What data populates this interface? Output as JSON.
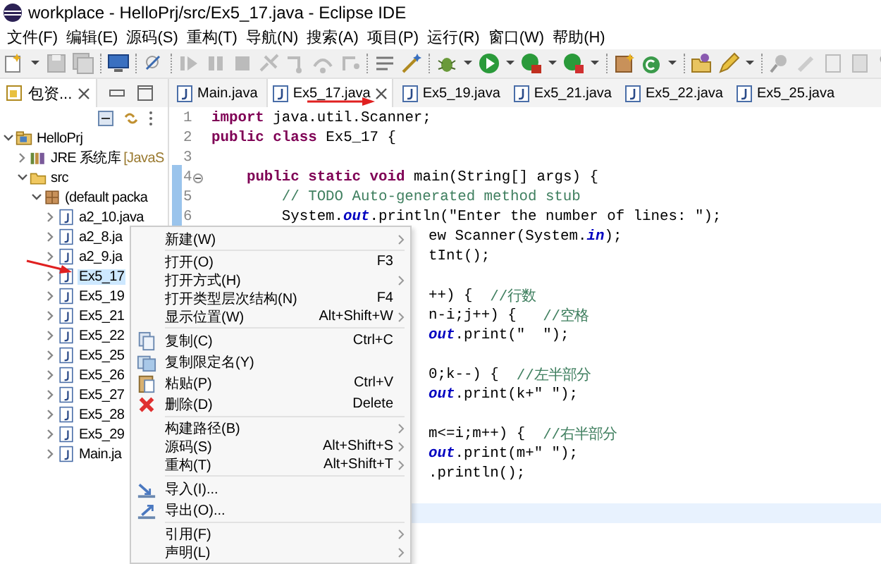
{
  "window": {
    "title": "workplace - HelloPrj/src/Ex5_17.java - Eclipse IDE"
  },
  "menu_bar": [
    "文件(F)",
    "编辑(E)",
    "源码(S)",
    "重构(T)",
    "导航(N)",
    "搜索(A)",
    "项目(P)",
    "运行(R)",
    "窗口(W)",
    "帮助(H)"
  ],
  "explorer": {
    "tab": "包资...",
    "tree": [
      {
        "label": "HelloPrj",
        "kind": "project",
        "expanded": true,
        "selected": false,
        "children": [
          {
            "label": "JRE 系统库",
            "suffix": "[JavaS",
            "kind": "library",
            "expanded": false,
            "selected": false
          },
          {
            "label": "src",
            "kind": "folder",
            "expanded": true,
            "selected": false,
            "children": [
              {
                "label": "(default packa",
                "kind": "package",
                "expanded": true,
                "selected": false,
                "children": [
                  {
                    "label": "a2_10.java",
                    "kind": "java",
                    "expanded": false,
                    "selected": false
                  },
                  {
                    "label": "a2_8.ja",
                    "kind": "java",
                    "expanded": false,
                    "selected": false
                  },
                  {
                    "label": "a2_9.ja",
                    "kind": "java",
                    "expanded": false,
                    "selected": false
                  },
                  {
                    "label": "Ex5_17",
                    "kind": "java",
                    "expanded": false,
                    "selected": true
                  },
                  {
                    "label": "Ex5_19",
                    "kind": "java",
                    "expanded": false,
                    "selected": false
                  },
                  {
                    "label": "Ex5_21",
                    "kind": "java",
                    "expanded": false,
                    "selected": false
                  },
                  {
                    "label": "Ex5_22",
                    "kind": "java",
                    "expanded": false,
                    "selected": false
                  },
                  {
                    "label": "Ex5_25",
                    "kind": "java",
                    "expanded": false,
                    "selected": false
                  },
                  {
                    "label": "Ex5_26",
                    "kind": "java",
                    "expanded": false,
                    "selected": false
                  },
                  {
                    "label": "Ex5_27",
                    "kind": "java",
                    "expanded": false,
                    "selected": false
                  },
                  {
                    "label": "Ex5_28",
                    "kind": "java",
                    "expanded": false,
                    "selected": false
                  },
                  {
                    "label": "Ex5_29",
                    "kind": "java",
                    "expanded": false,
                    "selected": false
                  },
                  {
                    "label": "Main.ja",
                    "kind": "java",
                    "expanded": false,
                    "selected": false
                  }
                ]
              }
            ]
          }
        ]
      }
    ]
  },
  "editor_tabs": [
    {
      "label": "Main.java",
      "selected": false
    },
    {
      "label": "Ex5_17.java",
      "selected": true
    },
    {
      "label": "Ex5_19.java",
      "selected": false
    },
    {
      "label": "Ex5_21.java",
      "selected": false
    },
    {
      "label": "Ex5_22.java",
      "selected": false
    },
    {
      "label": "Ex5_25.java",
      "selected": false
    }
  ],
  "code": [
    {
      "kind": "full",
      "number": "1",
      "text": "**import** java.util.Scanner;"
    },
    {
      "kind": "full",
      "number": "2",
      "text": "**public** **class** Ex5_17 {"
    },
    {
      "kind": "full",
      "number": "3"
    },
    {
      "kind": "full",
      "number": "4",
      "expanded": true,
      "text": "    **public** **static** **void** main(String[] args) {"
    },
    {
      "kind": "full",
      "number": "5",
      "comment": "        // TODO Auto-generated method stub"
    },
    {
      "kind": "full",
      "number": "6",
      "text": "        System.*out*.println(\"Enter the number of lines: \");"
    },
    {
      "kind": "clipped",
      "text": "ew Scanner(System.*in*);"
    },
    {
      "kind": "clipped",
      "text": "tInt();"
    },
    {
      "kind": "clipped"
    },
    {
      "kind": "clipped",
      "text": "++) {  ",
      "comment": "//行数"
    },
    {
      "kind": "clipped",
      "text": "n-i;j++) {   ",
      "comment": "//空格"
    },
    {
      "kind": "clipped",
      "text": "*out*.print(\"  \");"
    },
    {
      "kind": "clipped"
    },
    {
      "kind": "clipped",
      "text": "0;k--) {  ",
      "comment": "//左半部分"
    },
    {
      "kind": "clipped",
      "text": "*out*.print(k+\" \");"
    },
    {
      "kind": "clipped"
    },
    {
      "kind": "clipped",
      "text": "m<=i;m++) {  ",
      "comment": "//右半部分"
    },
    {
      "kind": "clipped",
      "text": "*out*.print(m+\" \");"
    },
    {
      "kind": "clipped",
      "text": ".println();"
    },
    {
      "kind": "clipped"
    },
    {
      "kind": "clipped",
      "current": true
    },
    {
      "kind": "clipped"
    }
  ],
  "context_menu": [
    {
      "kind": "item",
      "label": "新建(W)",
      "submenu": true
    },
    {
      "kind": "separator"
    },
    {
      "kind": "item",
      "label": "打开(O)",
      "shortcut": "F3",
      "submenu": false
    },
    {
      "kind": "item",
      "label": "打开方式(H)",
      "submenu": true
    },
    {
      "kind": "item",
      "label": "打开类型层次结构(N)",
      "shortcut": "F4",
      "submenu": false
    },
    {
      "kind": "item",
      "label": "显示位置(W)",
      "shortcut": "Alt+Shift+W",
      "submenu": true
    },
    {
      "kind": "separator"
    },
    {
      "kind": "copy",
      "label": "复制(C)",
      "shortcut": "Ctrl+C",
      "submenu": false
    },
    {
      "kind": "copyname",
      "label": "复制限定名(Y)",
      "submenu": false
    },
    {
      "kind": "paste",
      "label": "粘贴(P)",
      "shortcut": "Ctrl+V",
      "submenu": false
    },
    {
      "kind": "delete",
      "label": "删除(D)",
      "shortcut": "Delete",
      "submenu": false
    },
    {
      "kind": "separator"
    },
    {
      "kind": "item",
      "label": "构建路径(B)",
      "submenu": true
    },
    {
      "kind": "item",
      "label": "源码(S)",
      "shortcut": "Alt+Shift+S",
      "submenu": true
    },
    {
      "kind": "item",
      "label": "重构(T)",
      "shortcut": "Alt+Shift+T",
      "submenu": true
    },
    {
      "kind": "separator"
    },
    {
      "kind": "import",
      "label": "导入(I)...",
      "submenu": false
    },
    {
      "kind": "export",
      "label": "导出(O)...",
      "submenu": false
    },
    {
      "kind": "separator"
    },
    {
      "kind": "item",
      "label": "引用(F)",
      "submenu": true
    },
    {
      "kind": "item",
      "label": "声明(L)",
      "submenu": true
    }
  ]
}
